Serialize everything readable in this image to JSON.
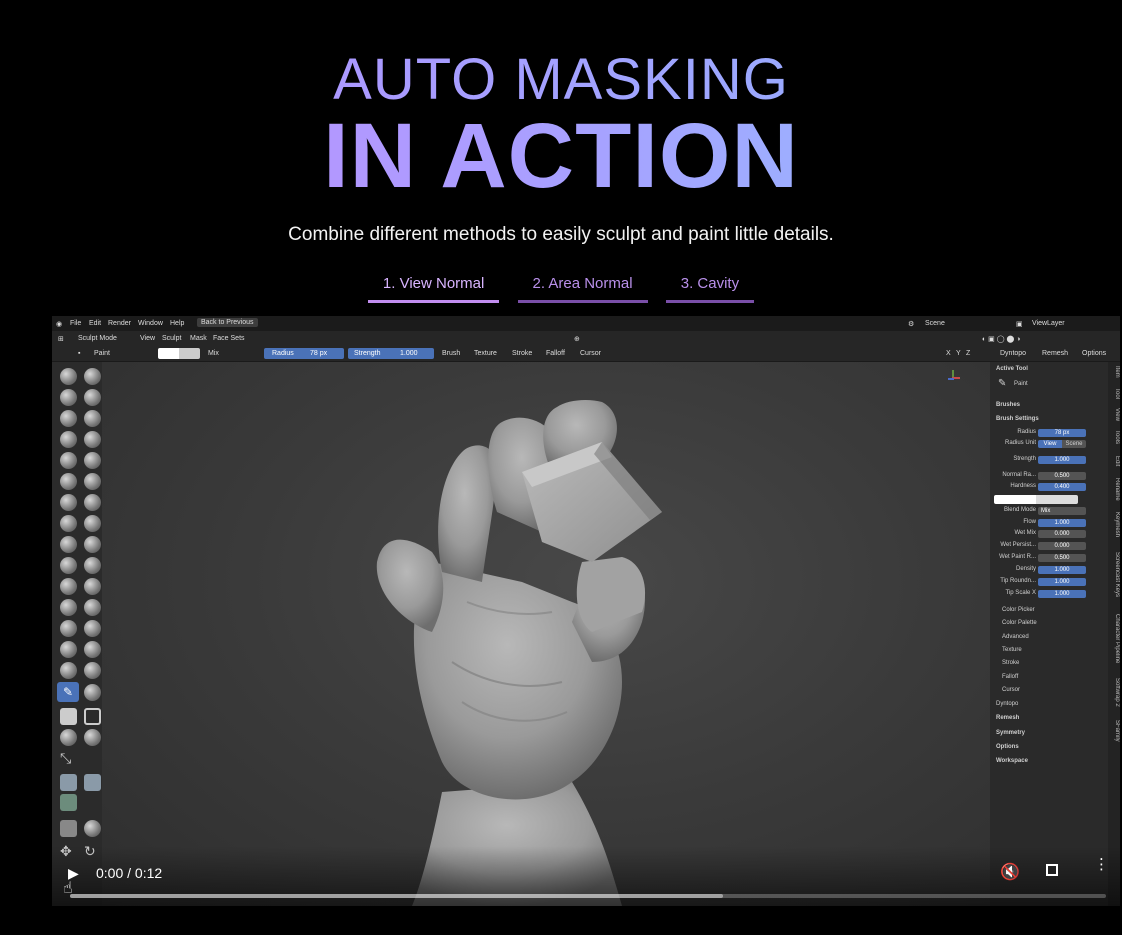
{
  "hero": {
    "title_line1": "AUTO MASKING",
    "title_line2": "IN ACTION",
    "subtitle": "Combine different methods to easily sculpt and paint little details."
  },
  "tabs": [
    {
      "label": "1. View Normal",
      "active": true
    },
    {
      "label": "2. Area Normal",
      "active": false
    },
    {
      "label": "3. Cavity",
      "active": false
    }
  ],
  "blender": {
    "menu": [
      "File",
      "Edit",
      "Render",
      "Window",
      "Help"
    ],
    "back_button": "Back to Previous",
    "scene": "Scene",
    "view_layer": "ViewLayer",
    "mode_menu": [
      "Sculpt Mode",
      "View",
      "Sculpt",
      "Mask",
      "Face Sets"
    ],
    "tool_header": {
      "tool_name": "Paint",
      "blend": "Mix",
      "radius_label": "Radius",
      "radius_value": "78 px",
      "strength_label": "Strength",
      "strength_value": "1.000",
      "menus": [
        "Brush",
        "Texture",
        "Stroke",
        "Falloff",
        "Cursor"
      ],
      "xyz": [
        "X",
        "Y",
        "Z"
      ],
      "right_menus": [
        "Dyntopo",
        "Remesh",
        "Options"
      ]
    },
    "panel": {
      "active_tool": "Active Tool",
      "tool": "Paint",
      "brushes": "Brushes",
      "brush_settings": "Brush Settings",
      "radius": {
        "label": "Radius",
        "value": "78 px"
      },
      "radius_unit": {
        "label": "Radius Unit",
        "opt1": "View",
        "opt2": "Scene"
      },
      "strength": {
        "label": "Strength",
        "value": "1.000"
      },
      "normal_radius": {
        "label": "Normal Ra...",
        "value": "0.500"
      },
      "hardness": {
        "label": "Hardness",
        "value": "0.400"
      },
      "blend_mode": {
        "label": "Blend Mode",
        "value": "Mix"
      },
      "flow": {
        "label": "Flow",
        "value": "1.000"
      },
      "wet_mix": {
        "label": "Wet Mix",
        "value": "0.000"
      },
      "wet_persist": {
        "label": "Wet Persist...",
        "value": "0.000"
      },
      "wet_paint": {
        "label": "Wet Paint R...",
        "value": "0.500"
      },
      "density": {
        "label": "Density",
        "value": "1.000"
      },
      "tip_roundness": {
        "label": "Tip Roundn...",
        "value": "1.000"
      },
      "tip_scale": {
        "label": "Tip Scale X",
        "value": "1.000"
      },
      "subpanels": [
        "Color Picker",
        "Color Palette",
        "Advanced",
        "Texture",
        "Stroke",
        "Falloff",
        "Cursor"
      ],
      "sections": [
        "Dyntopo",
        "Remesh",
        "Symmetry",
        "Options",
        "Workspace"
      ]
    },
    "side_tabs": [
      "Item",
      "Tool",
      "View",
      "Tools",
      "Edit",
      "Rename",
      "Keymesh",
      "Screencast Keys",
      "Character Pipeline",
      "Softwrap 2",
      "SFamily"
    ]
  },
  "player": {
    "time": "0:00 / 0:12",
    "progress": 0.63
  }
}
